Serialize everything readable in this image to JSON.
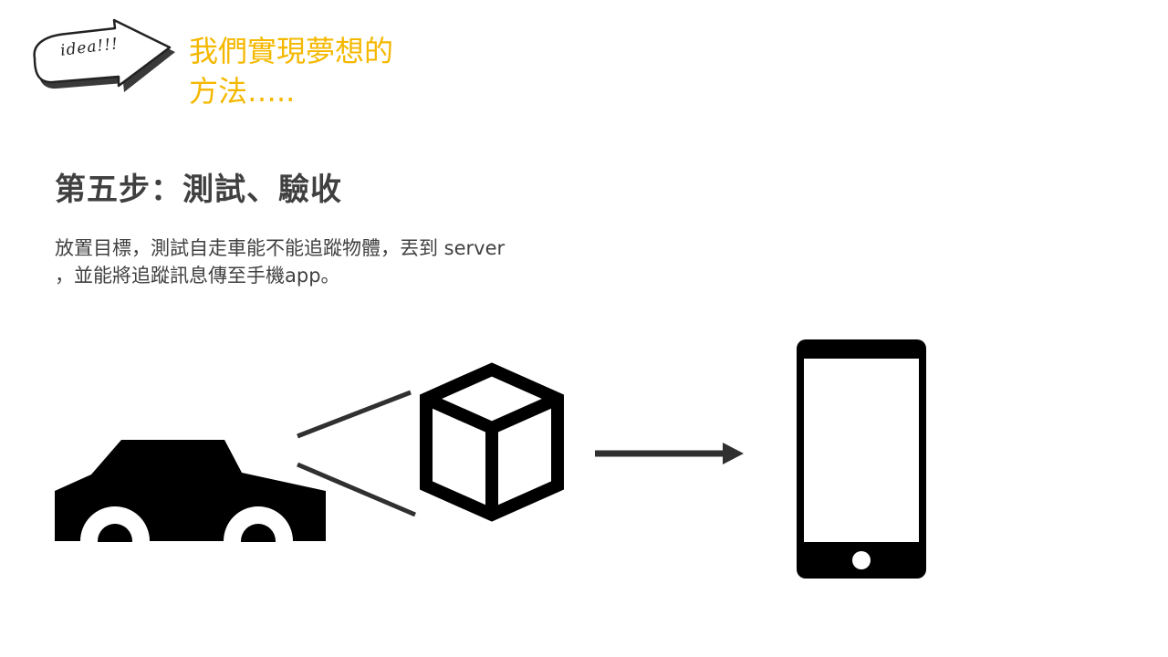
{
  "idea_badge": {
    "text": "idea!!!",
    "icon": "hand-drawn-arrow-icon"
  },
  "title": {
    "line1": "我們實現夢想的",
    "line2": "方法…..",
    "color": "#F5B800"
  },
  "step_heading": "第五步：測試、驗收",
  "description": {
    "line1": "放置目標，測試自走車能不能追蹤物體，丟到 server",
    "line2": "，並能將追蹤訊息傳至手機app。"
  },
  "diagram": {
    "car_icon": "car-icon",
    "target_icon": "cube-icon",
    "arrow_icon": "right-arrow-icon",
    "phone_icon": "smartphone-icon",
    "ink_color": "#000000",
    "line_color": "#303030"
  }
}
